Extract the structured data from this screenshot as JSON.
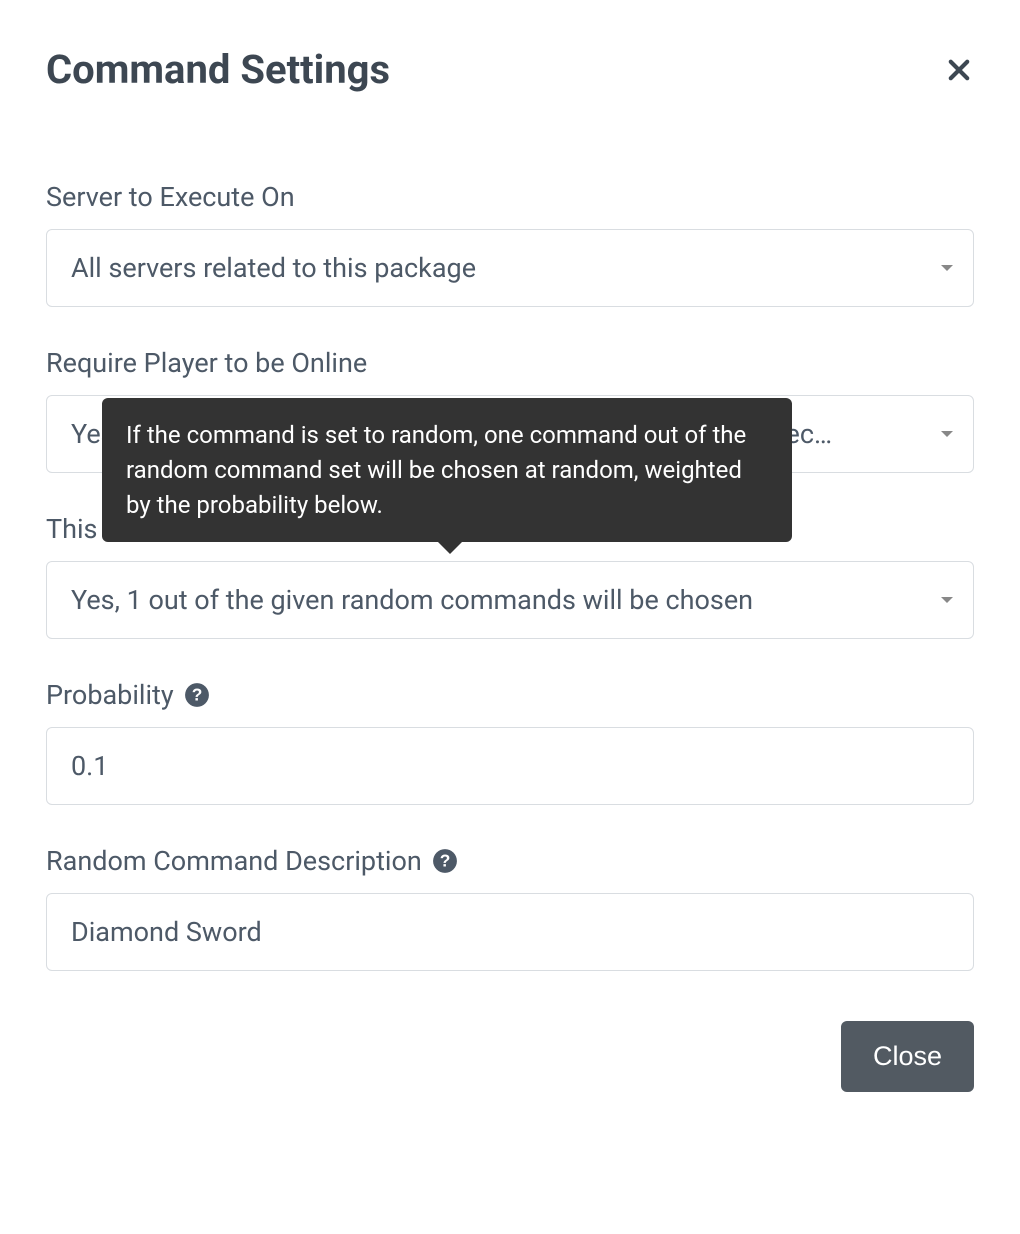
{
  "modal": {
    "title": "Command Settings",
    "close_button_label": "Close"
  },
  "tooltip": {
    "random_help": "If the command is set to random, one command out of the random command set will be chosen at random, weighted by the probability below."
  },
  "fields": {
    "server": {
      "label": "Server to Execute On",
      "value": "All servers related to this package"
    },
    "require_online": {
      "label": "Require Player to be Online",
      "value": "Yes, only execute the command when the player is online exec…"
    },
    "is_random": {
      "label": "This Command is Random",
      "value": "Yes, 1 out of the given random commands will be chosen"
    },
    "probability": {
      "label": "Probability",
      "value": "0.1"
    },
    "description": {
      "label": "Random Command Description",
      "value": "Diamond Sword"
    }
  }
}
